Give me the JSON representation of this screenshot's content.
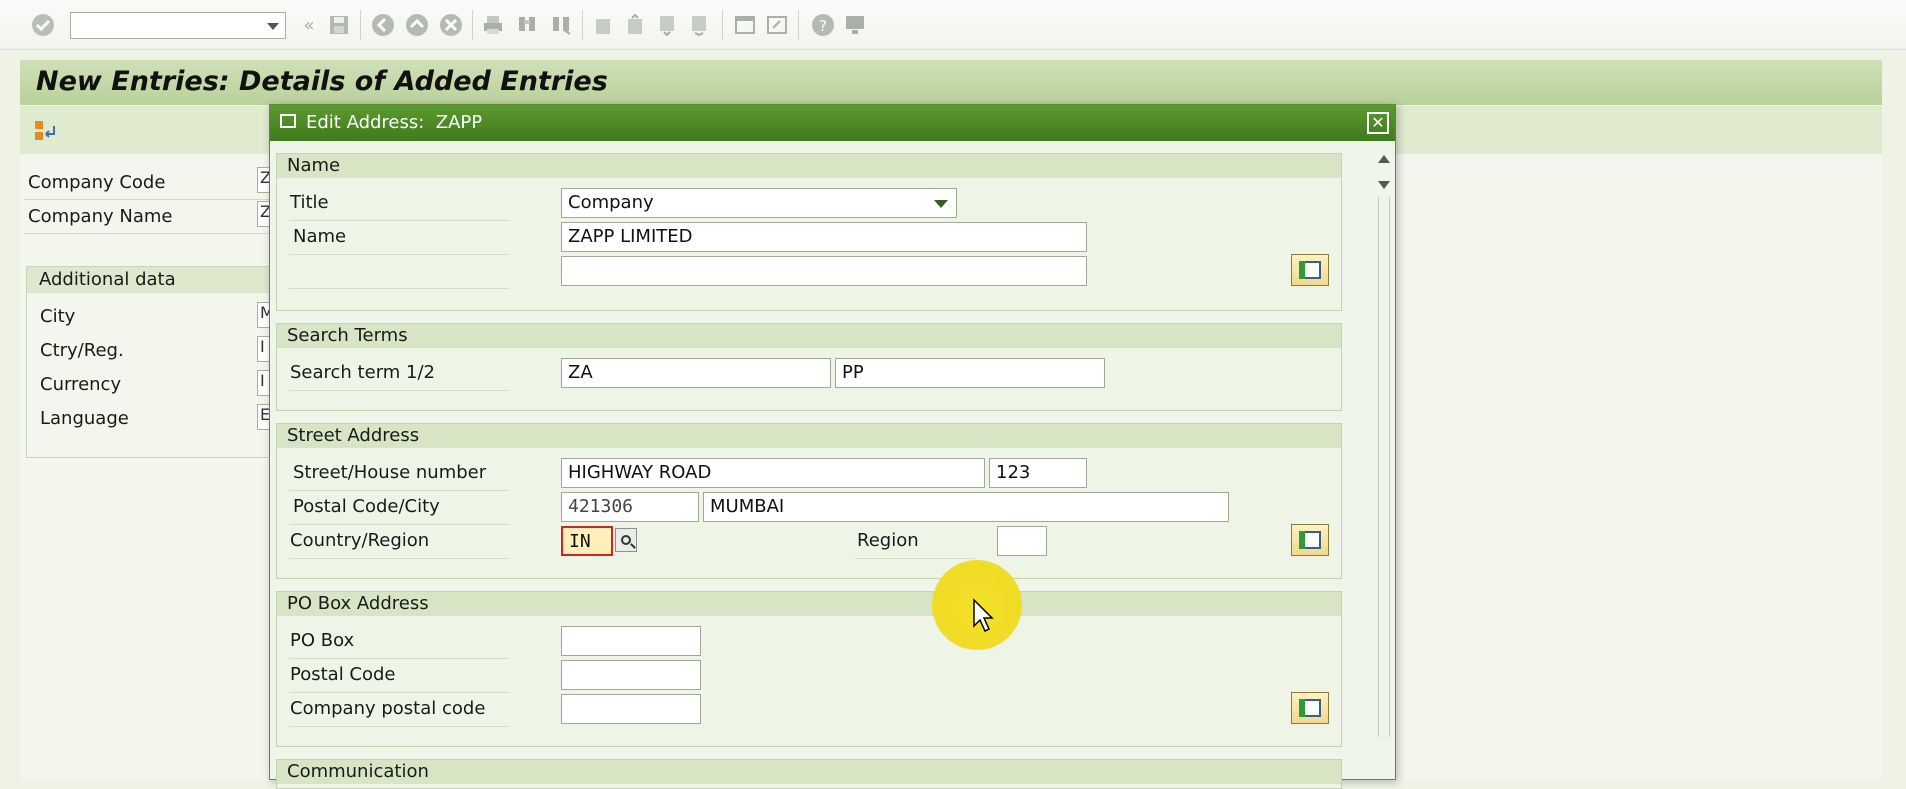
{
  "toolbar": {
    "icons": [
      "check-icon",
      "back-icon",
      "save-icon",
      "back-nav-icon",
      "exit-icon",
      "cancel-icon",
      "print-icon",
      "find-icon",
      "find-next-icon",
      "first-page-icon",
      "prev-page-icon",
      "next-page-icon",
      "last-page-icon",
      "new-session-icon",
      "shortcut-icon",
      "help-icon",
      "customize-icon"
    ]
  },
  "page": {
    "title": "New Entries: Details of Added Entries",
    "fields": {
      "company_code": "Company Code",
      "company_name": "Company Name"
    },
    "additional_data": {
      "header": "Additional data",
      "city": "City",
      "country": "Ctry/Reg.",
      "currency": "Currency",
      "language": "Language"
    },
    "stub_values": [
      "Z",
      "Z",
      "M",
      "I",
      "I",
      "E"
    ]
  },
  "dialog": {
    "title": "Edit Address:  ZAPP",
    "name_section": {
      "header": "Name",
      "title_label": "Title",
      "title_value": "Company",
      "name_label": "Name",
      "name_value": "ZAPP LIMITED",
      "name2_value": ""
    },
    "search_section": {
      "header": "Search Terms",
      "label": "Search term 1/2",
      "term1": "ZA",
      "term2": "PP"
    },
    "street_section": {
      "header": "Street Address",
      "street_label": "Street/House number",
      "street_value": "HIGHWAY ROAD",
      "house_value": "123",
      "postal_label": "Postal Code/City",
      "postal_value": "421306",
      "city_value": "MUMBAI",
      "country_label": "Country/Region",
      "country_value": "IN",
      "region_label": "Region",
      "region_value": ""
    },
    "pobox_section": {
      "header": "PO Box Address",
      "pobox_label": "PO Box",
      "postal_label": "Postal Code",
      "company_postal_label": "Company postal code"
    },
    "communication_section": {
      "header": "Communication"
    }
  }
}
